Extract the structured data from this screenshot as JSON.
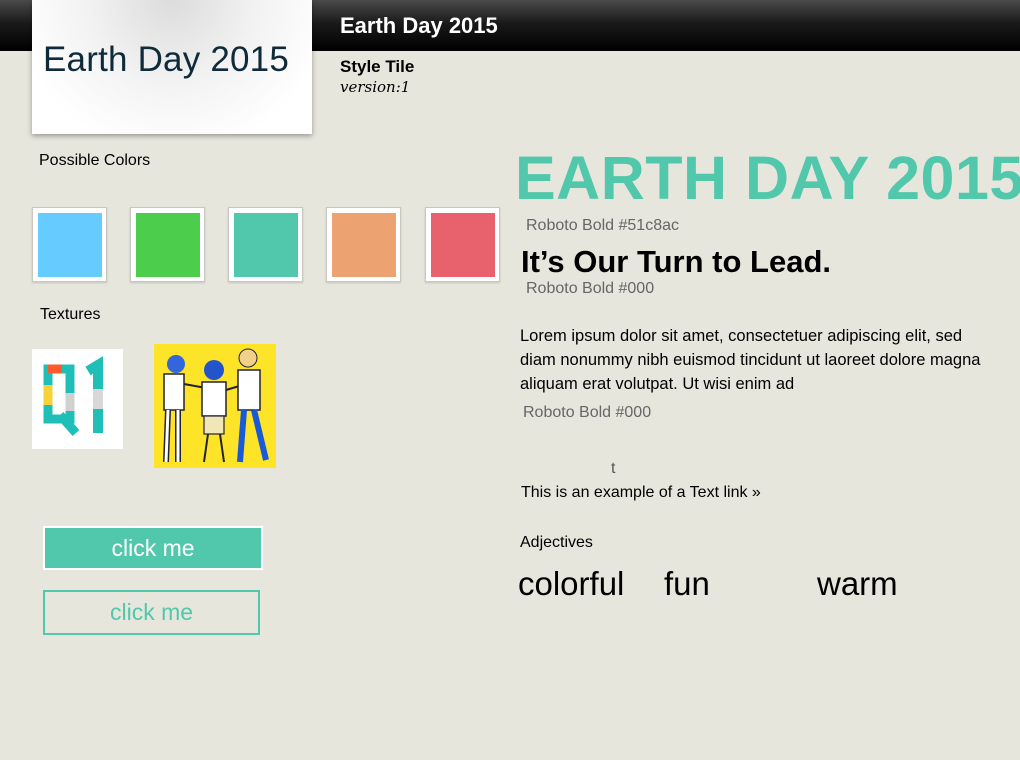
{
  "header": {
    "logo_text": "Earth Day 2015",
    "title": "Earth Day 2015",
    "style_tile": "Style Tile",
    "version": "version:1"
  },
  "colors": {
    "label": "Possible Colors",
    "swatches": [
      "#66ccff",
      "#4cce4c",
      "#51c8ac",
      "#eca271",
      "#e8626e"
    ]
  },
  "textures": {
    "label": "Textures"
  },
  "buttons": {
    "primary_label": "click me",
    "secondary_label": "click me",
    "accent": "#51c8ac"
  },
  "typography": {
    "hero": "EARTH DAY 2015",
    "hero_spec": "Roboto Bold #51c8ac",
    "headline": "It’s Our Turn to Lead.",
    "headline_spec": "Roboto Bold #000",
    "body": "Lorem ipsum dolor sit amet, consectetuer adipiscing elit, sed diam nonummy nibh euismod tincidunt ut laoreet dolore magna aliquam erat volutpat. Ut wisi enim ad",
    "body_spec": "Roboto Bold #000",
    "stray_char": "t",
    "text_link": "This is an example of a Text link »"
  },
  "adjectives": {
    "label": "Adjectives",
    "items": [
      "colorful",
      "fun",
      "warm"
    ]
  }
}
